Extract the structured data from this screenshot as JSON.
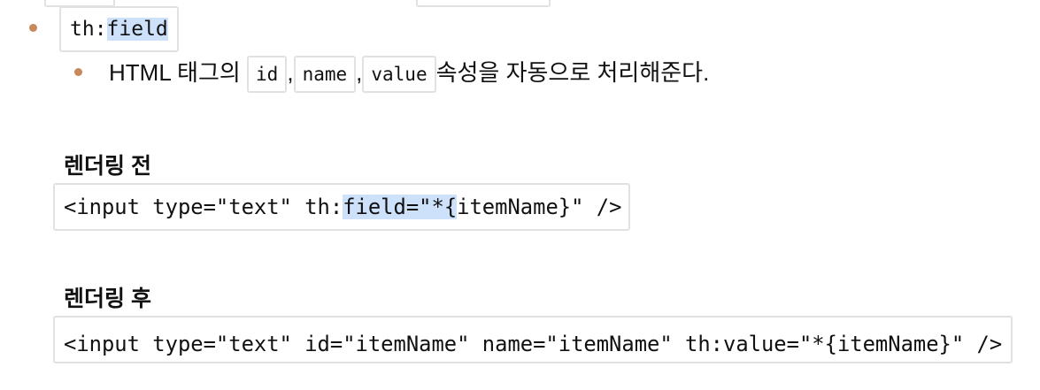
{
  "item": {
    "code_prefix": "th:",
    "code_highlight": "field"
  },
  "sub_item": {
    "prefix": "HTML 태그의 ",
    "attrs": [
      "id",
      "name",
      "value"
    ],
    "sep": ",",
    "suffix": "속성을 자동으로 처리해준다."
  },
  "before": {
    "title": "렌더링 전",
    "code_a": "<input type=\"text\" th:",
    "code_hl": "field=\"*{",
    "code_b": "itemName}\" />"
  },
  "after": {
    "title": "렌더링 후",
    "code": "<input type=\"text\" id=\"itemName\" name=\"itemName\" th:value=\"*{itemName}\" />"
  }
}
